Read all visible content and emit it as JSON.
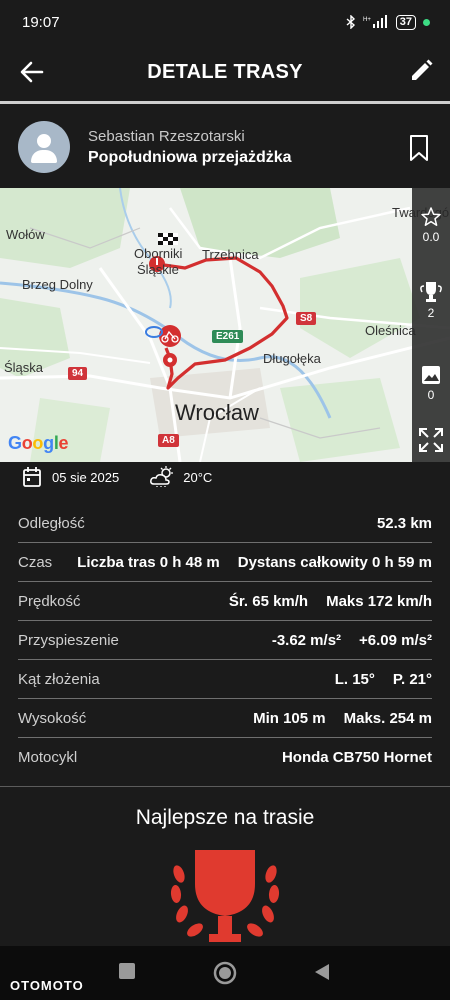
{
  "status_bar": {
    "time": "19:07",
    "battery": "37",
    "icons": [
      "bluetooth-icon",
      "signal-icon",
      "battery-icon"
    ]
  },
  "header": {
    "title": "DETALE TRASY",
    "back_icon": "arrow-left-icon",
    "edit_icon": "pencil-icon"
  },
  "user": {
    "name": "Sebastian Rzeszotarski",
    "route_name": "Popołudniowa przejażdżka"
  },
  "map": {
    "labels": [
      "Wołów",
      "Oborniki",
      "Śląskie",
      "Trzebnica",
      "Brzeg Dolny",
      "Twardogóra",
      "Oleśnica",
      "Długołęka",
      "Śląska",
      "Wrocław"
    ],
    "road_badges": [
      "E261",
      "S8",
      "94",
      "A8"
    ],
    "brand": "Google",
    "side": {
      "stars_value": "0.0",
      "trophies_value": "2",
      "photos_value": "0"
    }
  },
  "ride_info": {
    "date": "05 sie 2025",
    "temperature": "20°C"
  },
  "stats": [
    {
      "label": "Odległość",
      "values": [
        "52.3 km"
      ]
    },
    {
      "label": "Czas",
      "values": [
        "Liczba tras 0 h 48 m",
        "Dystans całkowity 0 h 59 m"
      ]
    },
    {
      "label": "Prędkość",
      "values": [
        "Śr. 65 km/h",
        "Maks 172 km/h"
      ]
    },
    {
      "label": "Przyspieszenie",
      "values": [
        "-3.62 m/s²",
        "+6.09 m/s²"
      ]
    },
    {
      "label": "Kąt złożenia",
      "values": [
        "L. 15°",
        "P. 21°"
      ]
    },
    {
      "label": "Wysokość",
      "values": [
        "Min 105 m",
        "Maks. 254 m"
      ]
    },
    {
      "label": "Motocykl",
      "values": [
        "Honda CB750 Hornet"
      ]
    }
  ],
  "best_section": {
    "title": "Najlepsze na trasie"
  },
  "watermark": "OTOMOTO",
  "colors": {
    "accent": "#e03a2f",
    "background": "#1b1b1b",
    "route": "#d32f2f"
  }
}
